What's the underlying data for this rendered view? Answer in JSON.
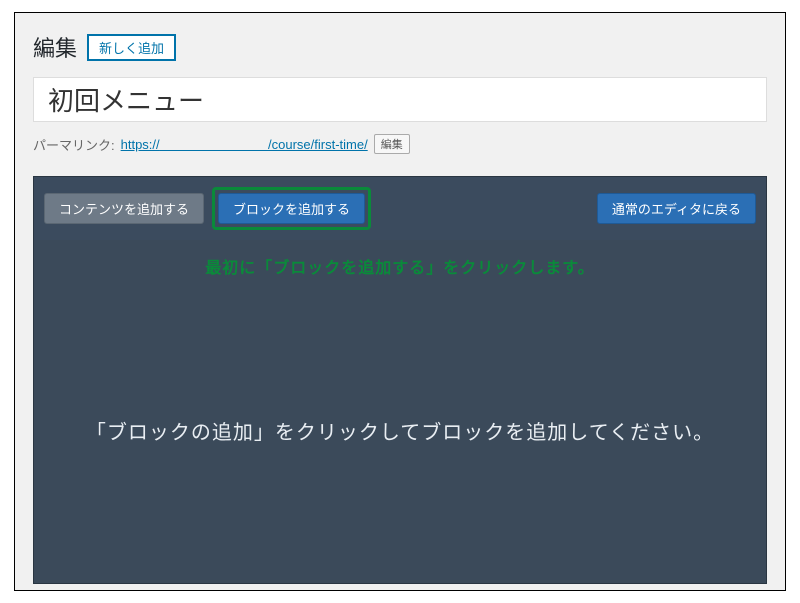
{
  "header": {
    "heading": "編集",
    "add_new_label": "新しく追加"
  },
  "title": {
    "value": "初回メニュー"
  },
  "permalink": {
    "label": "パーマリンク:",
    "url_prefix": "https://",
    "url_gap": "                              ",
    "url_suffix": "/course/first-time/",
    "edit_label": "編集"
  },
  "toolbar": {
    "add_content_label": "コンテンツを追加する",
    "add_block_label": "ブロックを追加する",
    "back_label": "通常のエディタに戻る"
  },
  "annotation": {
    "text": "最初に「ブロックを追加する」をクリックします。"
  },
  "editor": {
    "placeholder": "「ブロックの追加」をクリックしてブロックを追加してください。"
  }
}
